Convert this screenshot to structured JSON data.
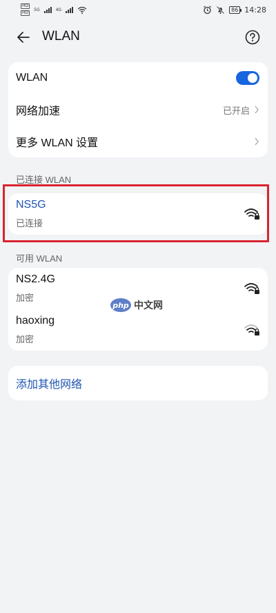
{
  "status_bar": {
    "sim1": "HD",
    "sim2": "HD",
    "net1": "5G",
    "net2": "4G",
    "battery": "86",
    "time": "14:28"
  },
  "header": {
    "title": "WLAN"
  },
  "settings": {
    "wlan_label": "WLAN",
    "wlan_enabled": true,
    "accelerate_label": "网络加速",
    "accelerate_value": "已开启",
    "more_label": "更多 WLAN 设置"
  },
  "connected_section": {
    "title": "已连接 WLAN",
    "network": {
      "name": "NS5G",
      "status": "已连接"
    }
  },
  "available_section": {
    "title": "可用 WLAN",
    "networks": [
      {
        "name": "NS2.4G",
        "status": "加密"
      },
      {
        "name": "haoxing",
        "status": "加密"
      }
    ]
  },
  "add_network": {
    "label": "添加其他网络"
  },
  "watermark": {
    "logo": "php",
    "text": "中文网"
  },
  "colors": {
    "accent": "#1865e0",
    "link": "#1d55b0",
    "highlight": "#d9232e",
    "background": "#f1f3f5"
  }
}
